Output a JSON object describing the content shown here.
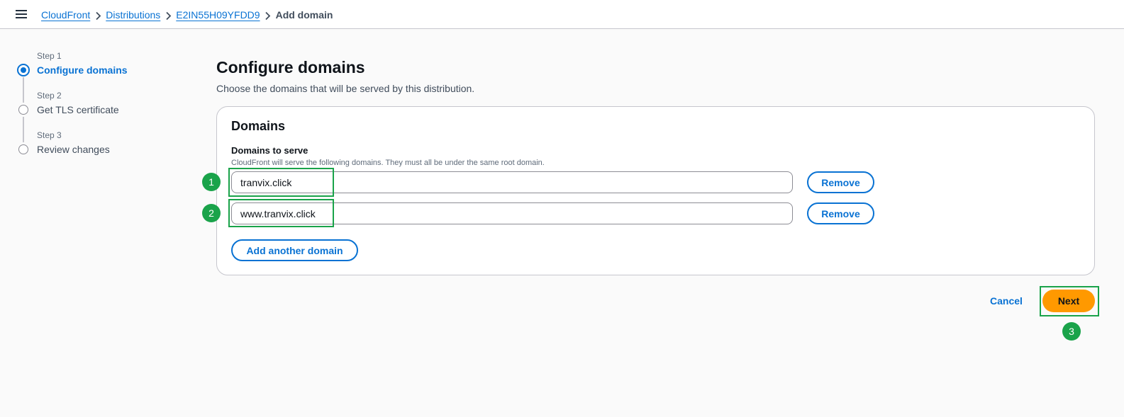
{
  "breadcrumb": {
    "items": [
      "CloudFront",
      "Distributions",
      "E2IN55H09YFDD9"
    ],
    "current": "Add domain"
  },
  "steps": [
    {
      "num": "Step 1",
      "title": "Configure domains",
      "state": "active"
    },
    {
      "num": "Step 2",
      "title": "Get TLS certificate",
      "state": "pending"
    },
    {
      "num": "Step 3",
      "title": "Review changes",
      "state": "pending"
    }
  ],
  "main": {
    "title": "Configure domains",
    "description": "Choose the domains that will be served by this distribution."
  },
  "panel": {
    "title": "Domains",
    "field_label": "Domains to serve",
    "field_desc": "CloudFront will serve the following domains. They must all be under the same root domain.",
    "domains": [
      {
        "value": "tranvix.click",
        "remove_label": "Remove"
      },
      {
        "value": "www.tranvix.click",
        "remove_label": "Remove"
      }
    ],
    "add_label": "Add another domain"
  },
  "actions": {
    "cancel_label": "Cancel",
    "next_label": "Next"
  },
  "annotations": [
    "1",
    "2",
    "3"
  ],
  "colors": {
    "link": "#0972d3",
    "primary_button": "#ff9900",
    "annotation": "#1aa34a"
  }
}
